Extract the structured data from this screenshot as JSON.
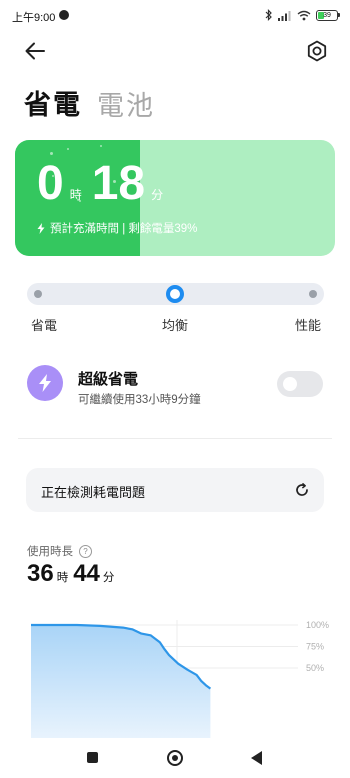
{
  "status_bar": {
    "time": "上午9:00",
    "battery_level": "39",
    "icons": [
      "bluetooth-icon",
      "signal-icon",
      "wifi-icon",
      "battery-icon"
    ]
  },
  "header": {
    "tabs": [
      {
        "label": "省電",
        "active": true
      },
      {
        "label": "電池",
        "active": false
      }
    ]
  },
  "battery_card": {
    "hours": "0",
    "hours_unit": "時",
    "minutes": "18",
    "minutes_unit": "分",
    "hint": "預計充滿時間 | 剩餘電量39%",
    "charge_fraction": 0.39,
    "colors": {
      "fill": "#34c75f",
      "empty": "#aeeec1"
    }
  },
  "mode_selector": {
    "options": [
      "省電",
      "均衡",
      "性能"
    ],
    "selected": "均衡",
    "accent": "#1e8cf0"
  },
  "super_saver": {
    "title": "超級省電",
    "subtitle": "可繼續使用33小時9分鐘",
    "enabled": false,
    "icon": "lightning-icon",
    "icon_color": "#a98ff7"
  },
  "detect": {
    "label": "正在檢測耗電問題",
    "icon": "refresh-icon"
  },
  "usage": {
    "label": "使用時長",
    "hours": "36",
    "hours_unit": "時",
    "minutes": "44",
    "minutes_unit": "分"
  },
  "chart_data": {
    "type": "area",
    "title": "",
    "xlabel": "",
    "ylabel": "",
    "ylim": [
      0,
      100
    ],
    "yticks": [
      "100%",
      "75%",
      "50%"
    ],
    "x": [
      0,
      5,
      10,
      15,
      20,
      22,
      24,
      26,
      28,
      29,
      30,
      32,
      34,
      36,
      37,
      38,
      39
    ],
    "values": [
      100,
      100,
      100,
      99,
      97,
      95,
      90,
      88,
      80,
      72,
      65,
      55,
      48,
      42,
      35,
      30,
      26
    ],
    "color": "#2e96e8"
  },
  "navbar": {
    "buttons": [
      "recents-button",
      "home-button",
      "back-button"
    ]
  }
}
